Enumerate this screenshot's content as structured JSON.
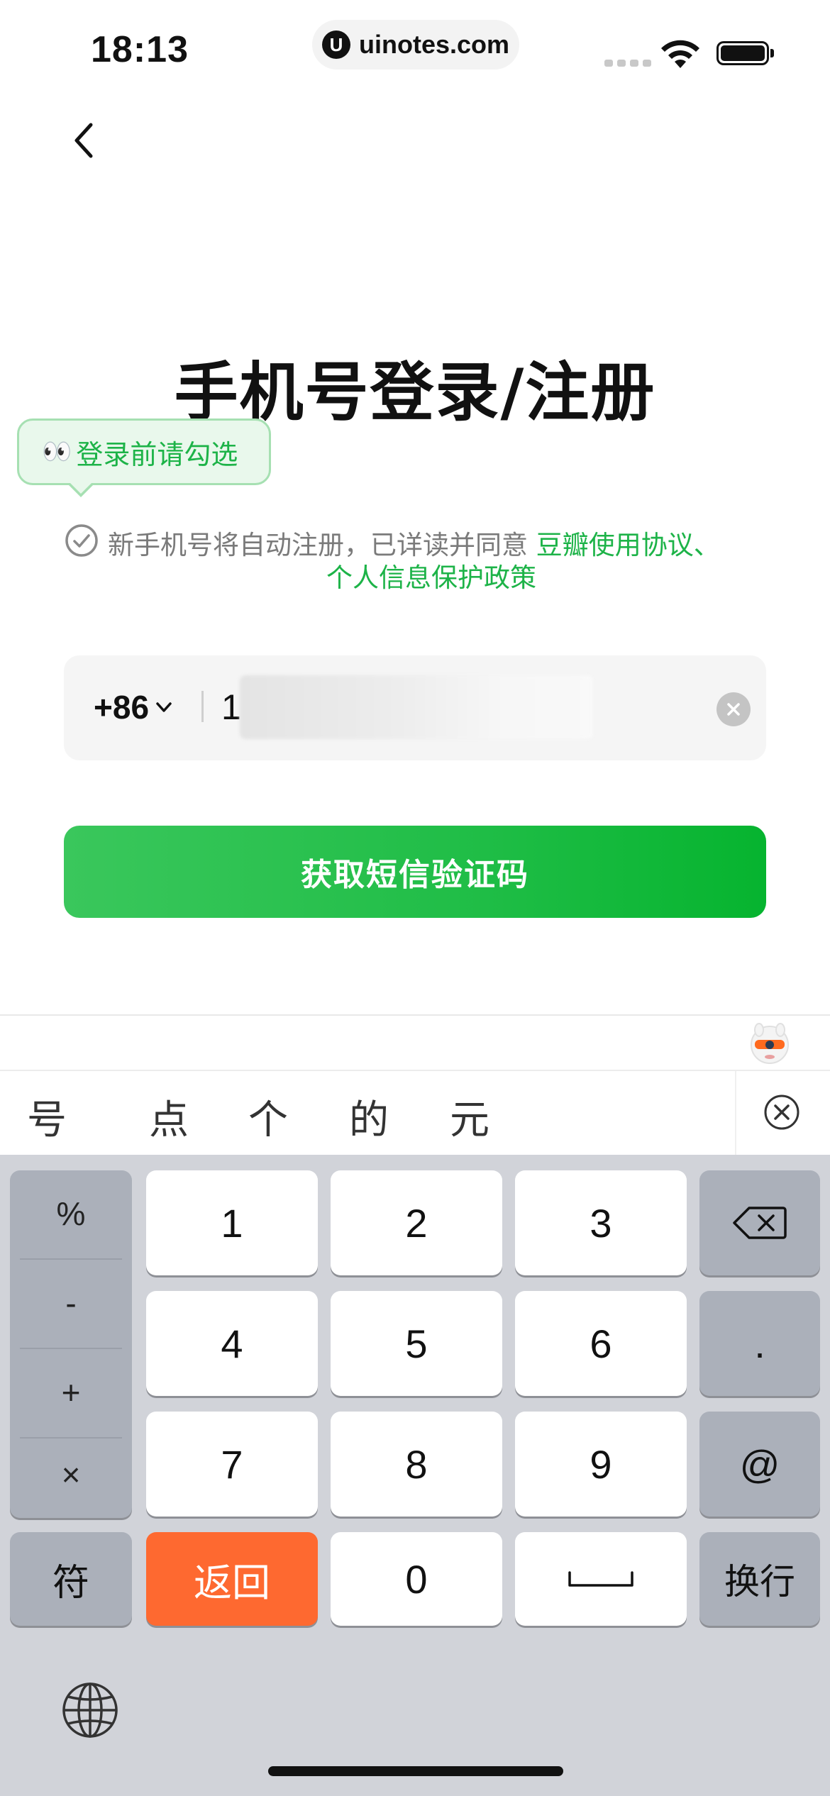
{
  "status_bar": {
    "time": "18:13",
    "url": "uinotes.com",
    "url_logo": "U"
  },
  "header": {
    "title": "手机号登录/注册"
  },
  "tooltip": {
    "eyes": "👀",
    "text": "登录前请勾选"
  },
  "agreement": {
    "text": "新手机号将自动注册，已详读并同意",
    "link1": "豆瓣使用协议、",
    "link2": "个人信息保护政策"
  },
  "phone": {
    "country_code": "+86",
    "value": "1"
  },
  "sms_button": {
    "label": "获取短信验证码"
  },
  "candidates": [
    "号",
    "点",
    "个",
    "的",
    "元"
  ],
  "keyboard": {
    "symbols": [
      "%",
      "-",
      "+",
      "×"
    ],
    "digits": [
      "1",
      "2",
      "3",
      "4",
      "5",
      "6",
      "7",
      "8",
      "9",
      "0"
    ],
    "dot": ".",
    "at": "@",
    "fu": "符",
    "back": "返回",
    "enter": "换行"
  },
  "colors": {
    "accent_green": "#1db348",
    "orange_key": "#fe6930",
    "keyboard_bg": "#d1d3d9"
  },
  "icons": [
    "back-chevron-icon",
    "check-circle-icon",
    "chevron-down-icon",
    "clear-icon",
    "delete-icon",
    "space-icon",
    "globe-icon",
    "mascot-icon",
    "close-circle-icon",
    "wifi-icon",
    "battery-icon"
  ]
}
